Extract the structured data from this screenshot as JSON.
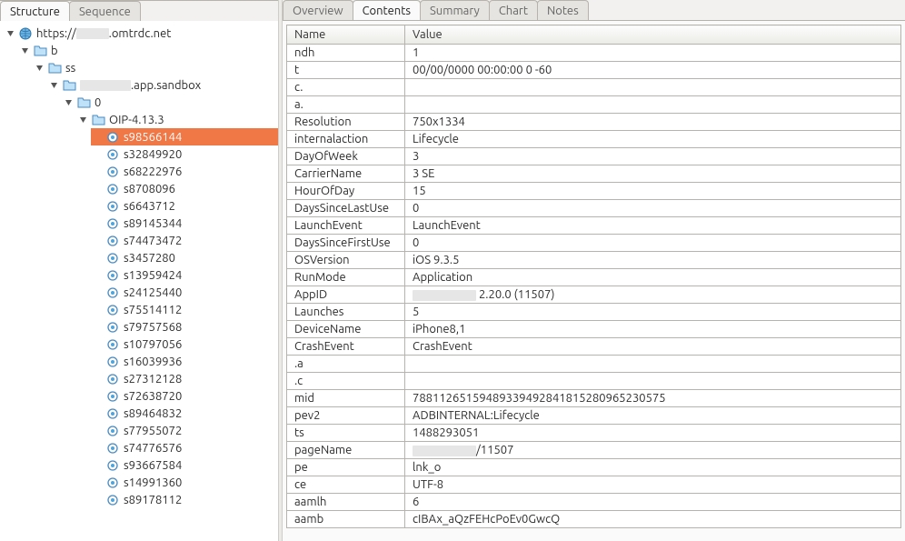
{
  "left_tabs": {
    "items": [
      "Structure",
      "Sequence"
    ],
    "active_index": 0
  },
  "right_tabs": {
    "items": [
      "Overview",
      "Contents",
      "Summary",
      "Chart",
      "Notes"
    ],
    "active_index": 1
  },
  "tree": {
    "root": {
      "label_prefix": "https://",
      "label_suffix": ".omtrdc.net",
      "redacted_width": 36
    },
    "b_label": "b",
    "ss_label": "ss",
    "sandbox_suffix": ".app.sandbox",
    "sandbox_redacted_width": 56,
    "zero_label": "0",
    "oip_label": "OIP-4.13.3",
    "leaves": [
      "s98566144",
      "s32849920",
      "s68222976",
      "s8708096",
      "s6643712",
      "s89145344",
      "s74473472",
      "s3457280",
      "s13959424",
      "s24125440",
      "s75514112",
      "s79757568",
      "s10797056",
      "s16039936",
      "s27312128",
      "s72638720",
      "s89464832",
      "s77955072",
      "s74776576",
      "s93667584",
      "s14991360",
      "s89178112"
    ],
    "selected_index": 0
  },
  "grid": {
    "headers": {
      "name": "Name",
      "value": "Value"
    },
    "rows": [
      {
        "name": "ndh",
        "value": "1"
      },
      {
        "name": "t",
        "value": "00/00/0000 00:00:00 0 -60"
      },
      {
        "name": "c.",
        "value": ""
      },
      {
        "name": "a.",
        "value": ""
      },
      {
        "name": "Resolution",
        "value": "750x1334"
      },
      {
        "name": "internalaction",
        "value": "Lifecycle"
      },
      {
        "name": "DayOfWeek",
        "value": "3"
      },
      {
        "name": "CarrierName",
        "value": "3 SE"
      },
      {
        "name": "HourOfDay",
        "value": "15"
      },
      {
        "name": "DaysSinceLastUse",
        "value": "0"
      },
      {
        "name": "LaunchEvent",
        "value": "LaunchEvent"
      },
      {
        "name": "DaysSinceFirstUse",
        "value": "0"
      },
      {
        "name": "OSVersion",
        "value": "iOS 9.3.5"
      },
      {
        "name": "RunMode",
        "value": "Application"
      },
      {
        "name": "AppID",
        "value": " 2.20.0 (11507)",
        "redacted": 70
      },
      {
        "name": "Launches",
        "value": "5"
      },
      {
        "name": "DeviceName",
        "value": "iPhone8,1"
      },
      {
        "name": "CrashEvent",
        "value": "CrashEvent"
      },
      {
        "name": ".a",
        "value": ""
      },
      {
        "name": ".c",
        "value": ""
      },
      {
        "name": "mid",
        "value": "78811265159489339492841815280965230575"
      },
      {
        "name": "pev2",
        "value": "ADBINTERNAL:Lifecycle"
      },
      {
        "name": "ts",
        "value": "1488293051"
      },
      {
        "name": "pageName",
        "value": "/11507",
        "redacted": 70
      },
      {
        "name": "pe",
        "value": "lnk_o"
      },
      {
        "name": "ce",
        "value": "UTF-8"
      },
      {
        "name": "aamlh",
        "value": "6"
      },
      {
        "name": "aamb",
        "value": "cIBAx_aQzFEHcPoEv0GwcQ"
      }
    ]
  }
}
